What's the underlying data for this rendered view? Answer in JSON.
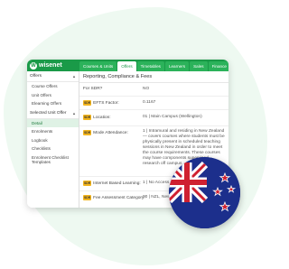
{
  "logo": {
    "mark": "W",
    "text": "wisenet"
  },
  "tabs": [
    {
      "label": "Courses & Units",
      "active": false
    },
    {
      "label": "Offers",
      "active": true
    },
    {
      "label": "Timetables",
      "active": false
    },
    {
      "label": "Learners",
      "active": false
    },
    {
      "label": "Sales",
      "active": false
    },
    {
      "label": "Finance",
      "active": false
    }
  ],
  "sidebar": {
    "sections": [
      {
        "title": "Offers",
        "items": [
          "Course Offers",
          "Unit Offers",
          "Elearning Offers"
        ]
      },
      {
        "title": "Selected Unit Offer",
        "items": [
          "Detail",
          "Enrolments",
          "Logbook",
          "Checklists",
          "Enrolment Checklist Templates"
        ]
      }
    ],
    "active_item": "Detail"
  },
  "main": {
    "title": "Reporting, Compliance & Fees",
    "sdr_badge": "SDR",
    "rows": [
      {
        "label": "For SDR?",
        "value": "NO",
        "badge": false
      },
      {
        "label": "EFTS Factor:",
        "value": "0.1167",
        "badge": true
      },
      {
        "label": "Location:",
        "value": "01 | Main Campus (Wellington)",
        "badge": true
      },
      {
        "label": "Mode Attendance:",
        "value": "1 | Intramural and residing in New Zealand — covers courses where students must be physically present in scheduled teaching sessions in New Zealand in order to meet the course requirements. These courses may have components supervised research off campus",
        "badge": true
      },
      {
        "label": "Internet Based Learning:",
        "value": "1 | No Access",
        "badge": true
      },
      {
        "label": "Fee Assessment Category:",
        "value": "00 | NZL, New Zealand (Residency + Y",
        "badge": true
      }
    ]
  },
  "colors": {
    "brand": "#1a9a48",
    "badge": "#f3b51d",
    "flag_blue": "#1c2f8c",
    "flag_red": "#cf2030"
  },
  "icons": [
    "chevron-up-icon",
    "new-zealand-flag-icon"
  ]
}
